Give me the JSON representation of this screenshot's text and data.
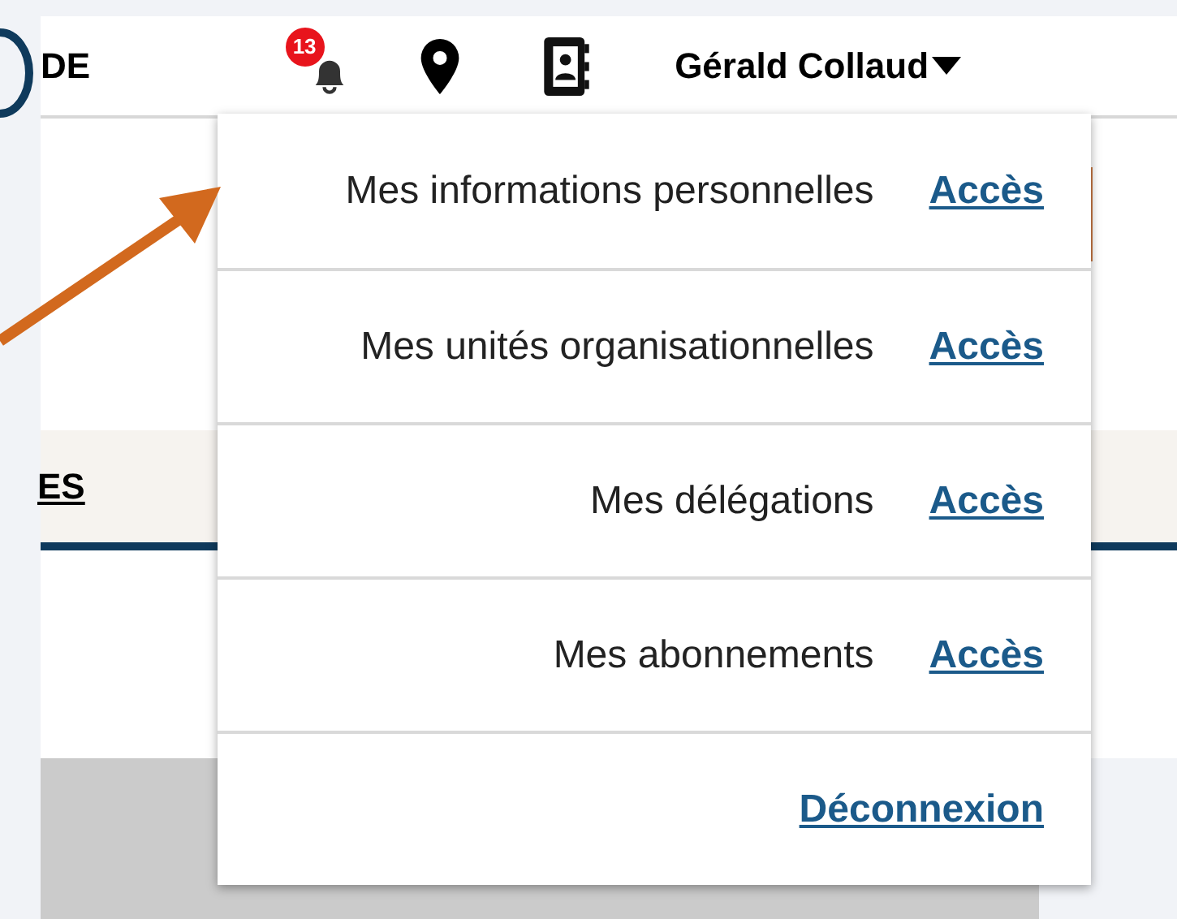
{
  "header": {
    "title_fragment": "DE",
    "notification_count": "13",
    "user_name": "Gérald Collaud",
    "menu_expanded": true
  },
  "section_tab": {
    "label_fragment": "ES"
  },
  "user_menu": [
    {
      "label": "Mes informations personnelles",
      "link": "Accès"
    },
    {
      "label": "Mes unités organisationnelles",
      "link": "Accès"
    },
    {
      "label": "Mes délégations",
      "link": "Accès"
    },
    {
      "label": "Mes abonnements",
      "link": "Accès"
    },
    {
      "link": "Déconnexion"
    }
  ]
}
